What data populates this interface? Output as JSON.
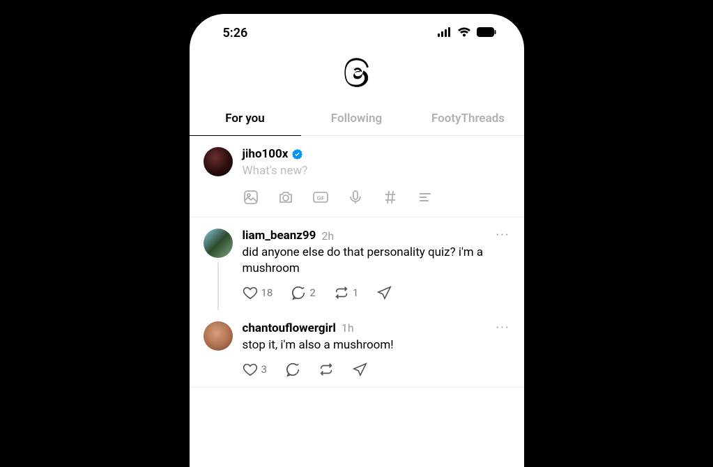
{
  "status": {
    "time": "5:26"
  },
  "tabs": [
    {
      "label": "For you",
      "active": true
    },
    {
      "label": "Following",
      "active": false
    },
    {
      "label": "FootyThreads",
      "active": false
    }
  ],
  "composer": {
    "username": "jiho100x",
    "placeholder": "What's new?"
  },
  "posts": [
    {
      "username": "liam_beanz99",
      "time": "2h",
      "text": "did anyone else do that personality quiz? i'm a mushroom",
      "likes": "18",
      "replies": "2",
      "reposts": "1",
      "shares": "",
      "has_thread": true
    },
    {
      "username": "chantouflowergirl",
      "time": "1h",
      "text": "stop it, i'm also a mushroom!",
      "likes": "3",
      "replies": "",
      "reposts": "",
      "shares": "",
      "has_thread": false
    }
  ]
}
